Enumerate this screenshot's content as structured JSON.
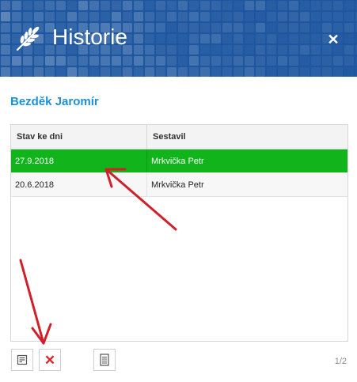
{
  "header": {
    "title": "Historie",
    "close_glyph": "✕",
    "background": "#1e57a0"
  },
  "person": {
    "name": "Bezděk Jaromír",
    "color": "#1c8fd6"
  },
  "table": {
    "columns": [
      "Stav ke dni",
      "Sestavil"
    ],
    "rows": [
      {
        "date": "27.9.2018",
        "author": "Mrkvička Petr",
        "selected": true
      },
      {
        "date": "20.6.2018",
        "author": "Mrkvička Petr",
        "selected": false
      }
    ],
    "selected_color": "#12b41c"
  },
  "toolbar": {
    "edit_icon": "edit-note-icon",
    "delete_glyph": "✕",
    "delete_color": "#d9262c",
    "document_icon": "document-icon"
  },
  "pager": {
    "text": "1/2"
  },
  "annotations": {
    "arrow_color": "#d0202a"
  }
}
